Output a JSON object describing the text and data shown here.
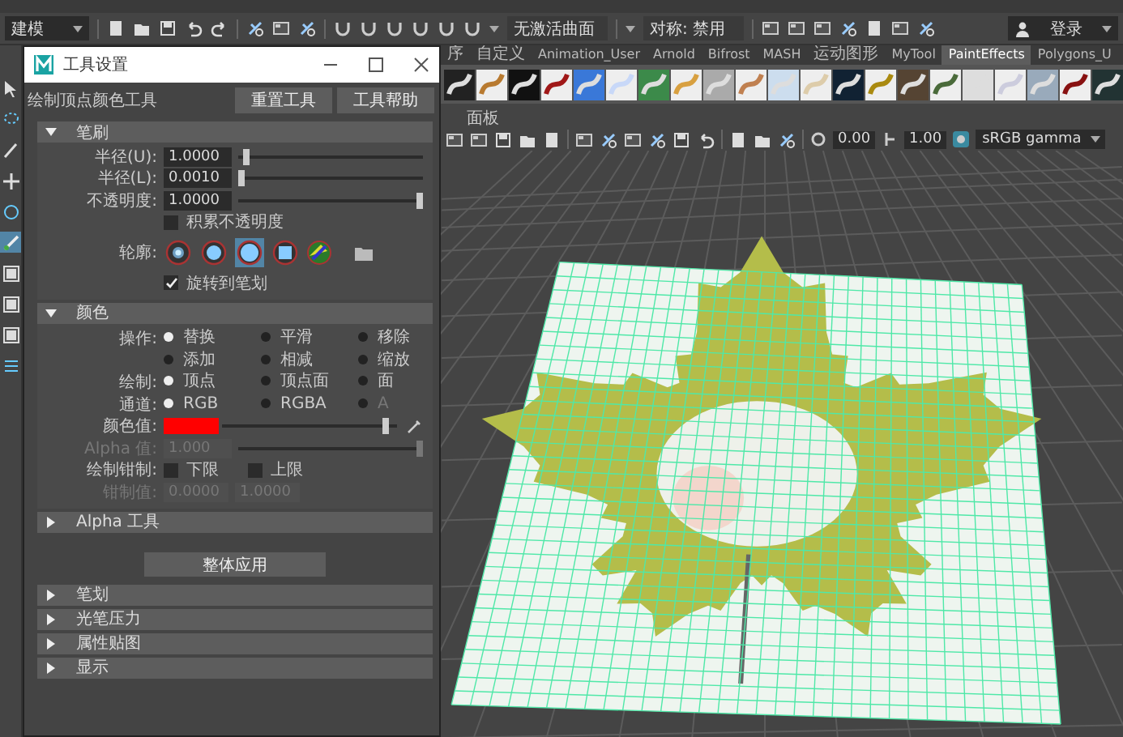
{
  "status_line": {
    "mode": "建模",
    "surface_field": "无激活曲面",
    "symmetry": "对称: 禁用",
    "login": "登录"
  },
  "toolbox": {
    "tools": [
      {
        "kind": "arrow",
        "selected": false
      },
      {
        "kind": "lasso",
        "selected": false
      },
      {
        "kind": "paint",
        "selected": false
      },
      {
        "kind": "move",
        "selected": false
      },
      {
        "kind": "rotate",
        "selected": false
      },
      {
        "kind": "brush",
        "selected": true
      },
      {
        "kind": "layout",
        "selected": false
      },
      {
        "kind": "layout",
        "selected": false
      },
      {
        "kind": "layout",
        "selected": false
      },
      {
        "kind": "list",
        "selected": false
      }
    ]
  },
  "shelf": {
    "tabs": [
      {
        "label": "序",
        "selected": false
      },
      {
        "label": "自定义",
        "selected": false
      },
      {
        "label": "Animation_User",
        "selected": false
      },
      {
        "label": "Arnold",
        "selected": false
      },
      {
        "label": "Bifrost",
        "selected": false
      },
      {
        "label": "MASH",
        "selected": false
      },
      {
        "label": "运动图形",
        "selected": false
      },
      {
        "label": "MyTool",
        "selected": false
      },
      {
        "label": "PaintEffects",
        "selected": true
      },
      {
        "label": "Polygons_U",
        "selected": false
      }
    ]
  },
  "panel_menu": {
    "items": [
      "面板"
    ]
  },
  "viewport_toolbar": {
    "exposure": "0.00",
    "gamma": "1.00",
    "color_space": "sRGB gamma"
  },
  "tool_settings": {
    "window_title": "工具设置",
    "tool_name": "绘制顶点颜色工具",
    "buttons": [
      "重置工具",
      "工具帮助"
    ],
    "sections": [
      {
        "label": "笔刷",
        "expanded": true,
        "rows": [
          {
            "kind": "slider",
            "label": "半径(U):",
            "value": "1.0000",
            "level": 0.03,
            "disabled": false
          },
          {
            "kind": "slider",
            "label": "半径(L):",
            "value": "0.0010",
            "level": 0.0,
            "disabled": false
          },
          {
            "kind": "slider",
            "label": "不透明度:",
            "value": "1.0000",
            "level": 1,
            "disabled": false
          },
          {
            "kind": "checkbox",
            "label": "积累不透明度",
            "checked": false
          },
          {
            "kind": "profiles",
            "label": "轮廓:",
            "options": [
              {
                "kind": "soft",
                "selected": false
              },
              {
                "kind": "round",
                "selected": false
              },
              {
                "kind": "round",
                "selected": true
              },
              {
                "kind": "square",
                "selected": false
              }
            ]
          },
          {
            "kind": "checkbox",
            "label": "旋转到笔划",
            "checked": true
          }
        ]
      },
      {
        "label": "颜色",
        "expanded": true,
        "rows": [
          {
            "kind": "radios",
            "label": "操作:",
            "options": [
              {
                "label": "替换",
                "selected": true,
                "disabled": false
              },
              {
                "label": "平滑",
                "selected": false,
                "disabled": false
              },
              {
                "label": "移除",
                "selected": false,
                "disabled": false
              },
              {
                "label": "添加",
                "selected": false,
                "disabled": false
              },
              {
                "label": "相减",
                "selected": false,
                "disabled": false
              },
              {
                "label": "缩放",
                "selected": false,
                "disabled": false
              }
            ]
          },
          {
            "kind": "radios",
            "label": "绘制:",
            "options": [
              {
                "label": "顶点",
                "selected": true,
                "disabled": false
              },
              {
                "label": "顶点面",
                "selected": false,
                "disabled": false
              },
              {
                "label": "面",
                "selected": false,
                "disabled": false
              }
            ]
          },
          {
            "kind": "radios",
            "label": "通道:",
            "options": [
              {
                "label": "RGB",
                "selected": true,
                "disabled": false
              },
              {
                "label": "RGBA",
                "selected": false,
                "disabled": false
              },
              {
                "label": "A",
                "selected": false,
                "disabled": true
              }
            ]
          },
          {
            "kind": "color",
            "label": "颜色值:",
            "color": "#ff0000",
            "level": 0.95
          },
          {
            "kind": "slider",
            "label": "Alpha 值:",
            "value": "1.000",
            "level": 1,
            "disabled": true
          },
          {
            "kind": "checkboxes",
            "label": "绘制钳制:",
            "options": [
              {
                "label": "下限",
                "checked": false
              },
              {
                "label": "上限",
                "checked": false
              }
            ]
          },
          {
            "kind": "fields",
            "label": "钳制值:",
            "values": [
              "0.0000",
              "1.0000"
            ],
            "disabled": true
          }
        ]
      },
      {
        "label": "Alpha 工具",
        "expanded": false
      }
    ],
    "apply_button": "整体应用",
    "more_sections": [
      {
        "label": "笔划",
        "expanded": false
      },
      {
        "label": "光笔压力",
        "expanded": false
      },
      {
        "label": "属性贴图",
        "expanded": false
      },
      {
        "label": "显示",
        "expanded": false
      }
    ]
  }
}
